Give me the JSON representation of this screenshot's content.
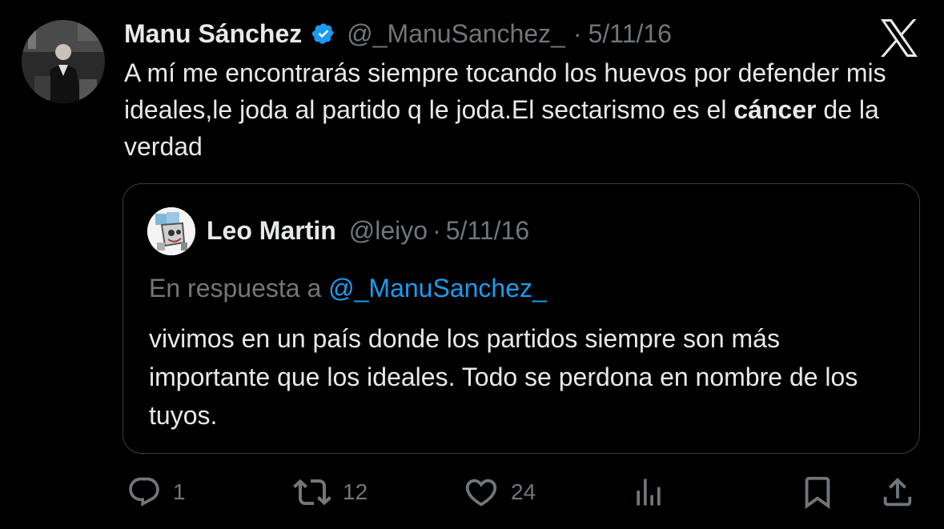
{
  "post": {
    "author_name": "Manu Sánchez",
    "handle": "@_ManuSanchez_",
    "separator": "·",
    "date": "5/11/16",
    "text_before": "A mí me encontrarás siempre tocando los huevos por defender mis ideales,le joda al partido q le joda.El sectarismo es el ",
    "text_bold": "cáncer",
    "text_after": " de la verdad"
  },
  "quote": {
    "author_name": "Leo Martin",
    "handle": "@leiyo",
    "separator": "·",
    "date": "5/11/16",
    "reply_prefix": "En respuesta a ",
    "reply_handle": "@_ManuSanchez_",
    "text": "vivimos en un país donde los partidos siempre son más importante que los ideales. Todo se perdona en nombre de los tuyos."
  },
  "actions": {
    "replies": "1",
    "reposts": "12",
    "likes": "24"
  },
  "icons": {
    "verified": "verified-badge-icon",
    "brand": "x-logo-icon",
    "reply": "reply-icon",
    "repost": "repost-icon",
    "like": "heart-icon",
    "views": "bar-chart-icon",
    "bookmark": "bookmark-icon",
    "share": "share-icon"
  },
  "colors": {
    "background": "#000000",
    "text": "#e7e9ea",
    "secondary": "#71767b",
    "link": "#1d9bf0",
    "verified": "#1d9bf0"
  }
}
